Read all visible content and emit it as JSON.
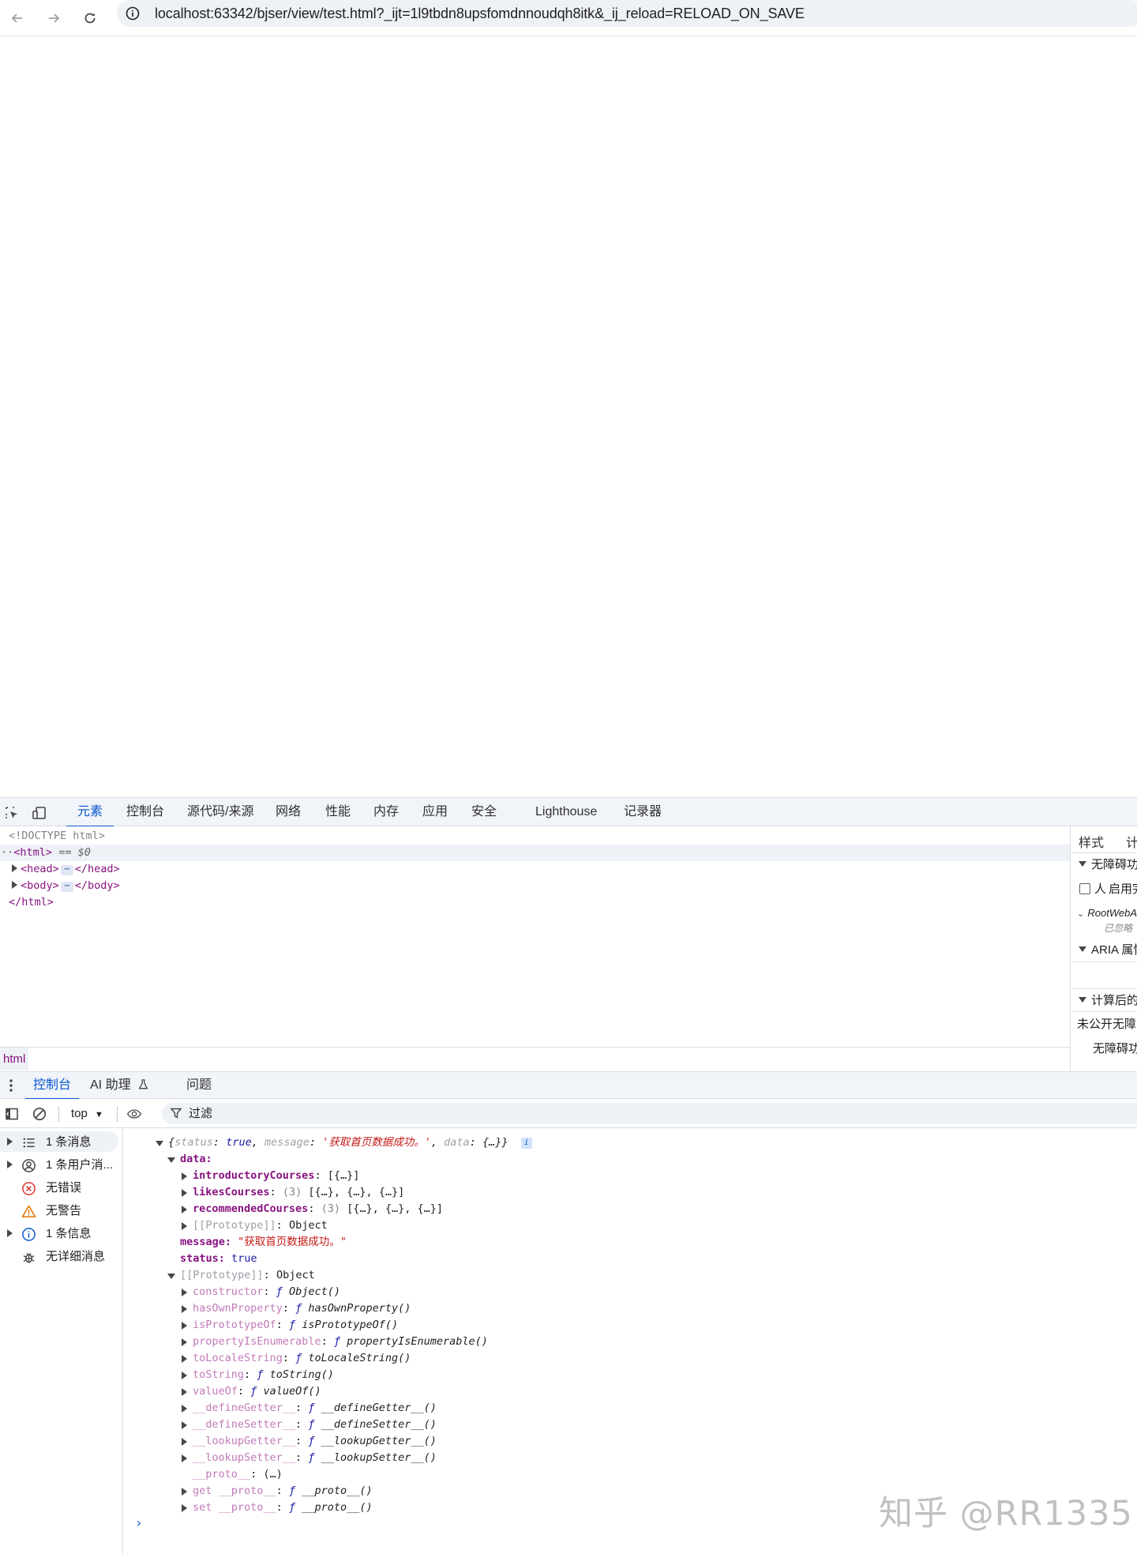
{
  "browser": {
    "url": "localhost:63342/bjser/view/test.html?_ijt=1l9tbdn8upsfomdnnoudqh8itk&_ij_reload=RELOAD_ON_SAVE"
  },
  "devtools": {
    "tabs": [
      "元素",
      "控制台",
      "源代码/来源",
      "网络",
      "性能",
      "内存",
      "应用",
      "安全",
      "Lighthouse",
      "记录器"
    ],
    "active_tab": "元素",
    "elements": {
      "doctype": "<!DOCTYPE html>",
      "html_open": "<html>",
      "selected_marker": "== $0",
      "head_open": "<head>",
      "head_close": "</head>",
      "body_open": "<body>",
      "body_close": "</body>",
      "html_close": "</html>",
      "ellipsis": "⋯"
    },
    "styles_panel": {
      "tabs": [
        "样式",
        "计"
      ],
      "rows": [
        "无障碍功",
        "启用完",
        "RootWebA",
        "已忽略",
        "ARIA 属性",
        "计算后的",
        "未公开无障",
        "无障碍功"
      ]
    },
    "breadcrumb": "html",
    "drawer": {
      "tabs": [
        "控制台",
        "AI 助理",
        "问题"
      ]
    },
    "console_toolbar": {
      "context": "top",
      "filter_placeholder": "过滤"
    },
    "console_sidebar": [
      {
        "label": "1 条消息",
        "icon": "list-icon",
        "expandable": true
      },
      {
        "label": "1 条用户消...",
        "icon": "user-icon",
        "expandable": true
      },
      {
        "label": "无错误",
        "icon": "error-icon",
        "expandable": false
      },
      {
        "label": "无警告",
        "icon": "warning-icon",
        "expandable": false
      },
      {
        "label": "1 条信息",
        "icon": "info-icon",
        "expandable": true
      },
      {
        "label": "无详细消息",
        "icon": "bug-icon",
        "expandable": false
      }
    ],
    "console_output": {
      "summary": {
        "open": "{",
        "status_key": "status",
        "status_val": "true",
        "message_key": "message",
        "message_val": "'获取首页数据成功。'",
        "data_key": "data",
        "data_val": "{…}",
        "close": "}"
      },
      "data": {
        "label": "data:",
        "children": [
          {
            "key": "introductoryCourses",
            "count": "",
            "value": "[{…}]"
          },
          {
            "key": "likesCourses",
            "count": "(3)",
            "value": "[{…}, {…}, {…}]"
          },
          {
            "key": "recommendedCourses",
            "count": "(3)",
            "value": "[{…}, {…}, {…}]"
          }
        ],
        "prototype": "[[Prototype]]",
        "prototype_val": "Object"
      },
      "message": {
        "key": "message:",
        "value": "\"获取首页数据成功。\""
      },
      "status": {
        "key": "status:",
        "value": "true"
      },
      "prototype": {
        "key": "[[Prototype]]",
        "value": "Object"
      },
      "proto_methods": [
        {
          "key": "constructor",
          "fn": "Object()"
        },
        {
          "key": "hasOwnProperty",
          "fn": "hasOwnProperty()"
        },
        {
          "key": "isPrototypeOf",
          "fn": "isPrototypeOf()"
        },
        {
          "key": "propertyIsEnumerable",
          "fn": "propertyIsEnumerable()"
        },
        {
          "key": "toLocaleString",
          "fn": "toLocaleString()"
        },
        {
          "key": "toString",
          "fn": "toString()"
        },
        {
          "key": "valueOf",
          "fn": "valueOf()"
        },
        {
          "key": "__defineGetter__",
          "fn": "__defineGetter__()"
        },
        {
          "key": "__defineSetter__",
          "fn": "__defineSetter__()"
        },
        {
          "key": "__lookupGetter__",
          "fn": "__lookupGetter__()"
        },
        {
          "key": "__lookupSetter__",
          "fn": "__lookupSetter__()"
        }
      ],
      "proto_accessor": {
        "key": "__proto__",
        "value": "(…)"
      },
      "proto_getset": [
        {
          "key": "get __proto__",
          "fn": "__proto__()"
        },
        {
          "key": "set __proto__",
          "fn": "__proto__()"
        }
      ],
      "fn_marker": "ƒ",
      "prompt": "›"
    }
  },
  "watermark": "知乎 @RR1335",
  "colors": {
    "accent": "#0b57d0",
    "tag": "#881280",
    "string": "#c41a16",
    "boolean": "#1a1aa6"
  }
}
